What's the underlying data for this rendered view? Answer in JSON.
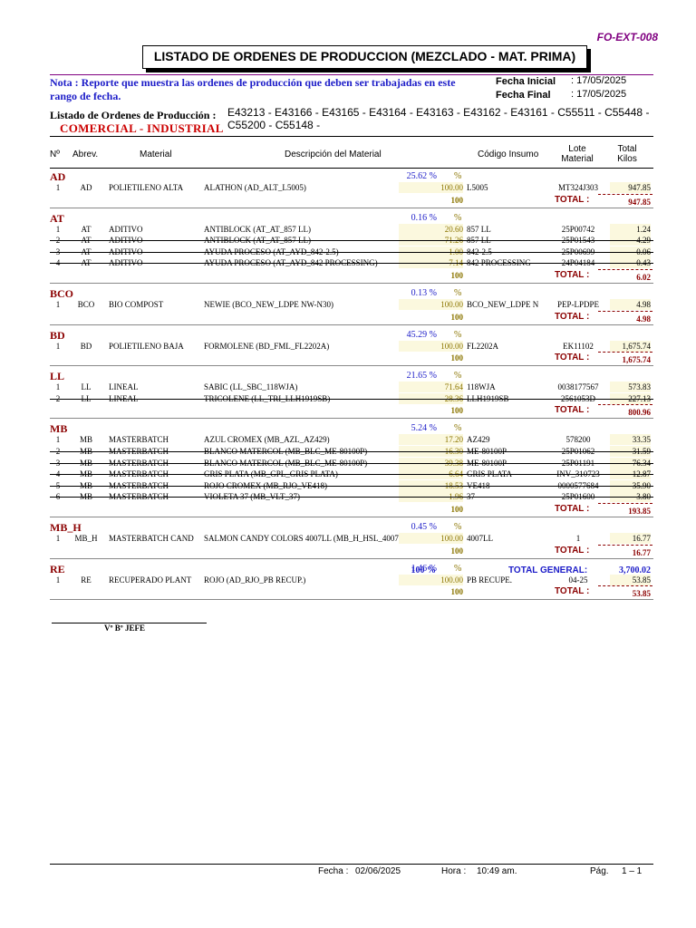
{
  "form_code": "FO-EXT-008",
  "title": "LISTADO DE ORDENES DE PRODUCCION (MEZCLADO - MAT. PRIMA)",
  "note": "Nota : Reporte que muestra las ordenes de producción que deben ser trabajadas en este rango de fecha.",
  "fecha_inicial_label": "Fecha Inicial",
  "fecha_inicial_value": ": 17/05/2025",
  "fecha_final_label": "Fecha Final",
  "fecha_final_value": ": 17/05/2025",
  "orders_label": "Listado de Ordenes de Producción :",
  "orders_list": "E43213 - E43166 - E43165 - E43164 - E43163 - E43162 - E43161 - C55511 - C55448 - C55200 - C55148 -",
  "segment": "COMERCIAL - INDUSTRIAL",
  "headers": {
    "no": "Nº",
    "abrev": "Abrev.",
    "material": "Material",
    "descripcion": "Descripción del Material",
    "codigo": "Código Insumo",
    "lote": "Lote Material",
    "total": "Total Kilos"
  },
  "groups": [
    {
      "code": "AD",
      "pct": "25.62 %",
      "pct_sign": "%",
      "subtotal_pct": "100",
      "total_label": "TOTAL :",
      "total": "947.85",
      "rows": [
        {
          "idx": "1",
          "abr": "AD",
          "mat": "POLIETILENO ALTA",
          "desc": "ALATHON (AD_ALT_L5005)",
          "pct": "100.00",
          "code": "L5005",
          "lote": "MT324J303",
          "kilos": "947.85",
          "strike": false
        }
      ]
    },
    {
      "code": "AT",
      "pct": "0.16 %",
      "pct_sign": "%",
      "subtotal_pct": "100",
      "total_label": "TOTAL :",
      "total": "6.02",
      "rows": [
        {
          "idx": "1",
          "abr": "AT",
          "mat": "ADITIVO",
          "desc": "ANTIBLOCK (AT_AT_857 LL)",
          "pct": "20.60",
          "code": "857 LL",
          "lote": "25P00742",
          "kilos": "1.24",
          "strike": false
        },
        {
          "idx": "2",
          "abr": "AT",
          "mat": "ADITIVO",
          "desc": "ANTIBLOCK (AT_AT_857 LL)",
          "pct": "71.26",
          "code": "857 LL",
          "lote": "25P01543",
          "kilos": "4.29",
          "strike": true
        },
        {
          "idx": "3",
          "abr": "AT",
          "mat": "ADITIVO",
          "desc": "AYUDA PROCESO (AT_AYD_842-2.5)",
          "pct": "1.00",
          "code": "842-2.5",
          "lote": "25P00699",
          "kilos": "0.06",
          "strike": true
        },
        {
          "idx": "4",
          "abr": "AT",
          "mat": "ADITIVO",
          "desc": "AYUDA PROCESO (AT_AYD_842 PROCESSING)",
          "pct": "7.14",
          "code": "842 PROCESSING",
          "lote": "24P04184",
          "kilos": "0.43",
          "strike": true
        }
      ]
    },
    {
      "code": "BCO",
      "pct": "0.13 %",
      "pct_sign": "%",
      "subtotal_pct": "100",
      "total_label": "TOTAL :",
      "total": "4.98",
      "rows": [
        {
          "idx": "1",
          "abr": "BCO",
          "mat": "BIO COMPOST",
          "desc": "NEWIE (BCO_NEW_LDPE NW-N30)",
          "pct": "100.00",
          "code": "BCO_NEW_LDPE N",
          "lote": "PEP-LPDPE",
          "kilos": "4.98",
          "strike": false
        }
      ]
    },
    {
      "code": "BD",
      "pct": "45.29 %",
      "pct_sign": "%",
      "subtotal_pct": "100",
      "total_label": "TOTAL :",
      "total": "1,675.74",
      "rows": [
        {
          "idx": "1",
          "abr": "BD",
          "mat": "POLIETILENO BAJA",
          "desc": "FORMOLENE (BD_FML_FL2202A)",
          "pct": "100.00",
          "code": "FL2202A",
          "lote": "EK11102",
          "kilos": "1,675.74",
          "strike": false
        }
      ]
    },
    {
      "code": "LL",
      "pct": "21.65 %",
      "pct_sign": "%",
      "subtotal_pct": "100",
      "total_label": "TOTAL :",
      "total": "800.96",
      "rows": [
        {
          "idx": "1",
          "abr": "LL",
          "mat": "LINEAL",
          "desc": "SABIC (LL_SBC_118WJA)",
          "pct": "71.64",
          "code": "118WJA",
          "lote": "0038177567",
          "kilos": "573.83",
          "strike": false
        },
        {
          "idx": "2",
          "abr": "LL",
          "mat": "LINEAL",
          "desc": "TRICOLENE (LL_TRI_LLH1919SB)",
          "pct": "28.36",
          "code": "LLH1919SB",
          "lote": "2561053D",
          "kilos": "227.13",
          "strike": true
        }
      ]
    },
    {
      "code": "MB",
      "pct": "5.24 %",
      "pct_sign": "%",
      "subtotal_pct": "100",
      "total_label": "TOTAL :",
      "total": "193.85",
      "rows": [
        {
          "idx": "1",
          "abr": "MB",
          "mat": "MASTERBATCH",
          "desc": "AZUL  CROMEX (MB_AZL_AZ429)",
          "pct": "17.20",
          "code": "AZ429",
          "lote": "578200",
          "kilos": "33.35",
          "strike": false
        },
        {
          "idx": "2",
          "abr": "MB",
          "mat": "MASTERBATCH",
          "desc": "BLANCO MATERCOL (MB_BLC_ME-80100P)",
          "pct": "16.30",
          "code": "ME-80100P",
          "lote": "25P01062",
          "kilos": "31.59",
          "strike": true
        },
        {
          "idx": "3",
          "abr": "MB",
          "mat": "MASTERBATCH",
          "desc": "BLANCO MATERCOL (MB_BLC_ME-80100P)",
          "pct": "39.38",
          "code": "ME-80100P",
          "lote": "25P01191",
          "kilos": "76.34",
          "strike": true
        },
        {
          "idx": "4",
          "abr": "MB",
          "mat": "MASTERBATCH",
          "desc": "GRIS PLATA (MB_GPL_GRIS PLATA)",
          "pct": "6.64",
          "code": "GRIS PLATA",
          "lote": "INV_310723",
          "kilos": "12.87",
          "strike": true
        },
        {
          "idx": "5",
          "abr": "MB",
          "mat": "MASTERBATCH",
          "desc": "ROJO CROMEX (MB_RJO_VE418)",
          "pct": "18.53",
          "code": "VE418",
          "lote": "0000577684",
          "kilos": "35.90",
          "strike": true
        },
        {
          "idx": "6",
          "abr": "MB",
          "mat": "MASTERBATCH",
          "desc": "VIOLETA 37 (MB_VLT_37)",
          "pct": "1.96",
          "code": "37",
          "lote": "25P01600",
          "kilos": "3.80",
          "strike": true
        }
      ]
    },
    {
      "code": "MB_H",
      "pct": "0.45 %",
      "pct_sign": "%",
      "subtotal_pct": "100",
      "total_label": "TOTAL :",
      "total": "16.77",
      "rows": [
        {
          "idx": "1",
          "abr": "MB_H",
          "mat": "MASTERBATCH CAND",
          "desc": "SALMON CANDY COLORS 4007LL (MB_H_HSL_4007LL)",
          "pct": "100.00",
          "code": "4007LL",
          "lote": "1",
          "kilos": "16.77",
          "strike": false
        }
      ]
    },
    {
      "code": "RE",
      "pct": "1.46 %",
      "pct_sign": "%",
      "subtotal_pct": "100",
      "total_label": "TOTAL :",
      "total": "53.85",
      "rows": [
        {
          "idx": "1",
          "abr": "RE",
          "mat": "RECUPERADO PLANT",
          "desc": "ROJO (AD_RJO_PB RECUP.)",
          "pct": "100.00",
          "code": "PB RECUPE.",
          "lote": "04-25",
          "kilos": "53.85",
          "strike": false
        }
      ]
    }
  ],
  "grand_pct": "100 %",
  "grand_label": "TOTAL GENERAL:",
  "grand_total": "3,700.02",
  "sign_label": "Vº Bº JEFE",
  "footer": {
    "fecha_label": "Fecha :",
    "fecha_value": "02/06/2025",
    "hora_label": "Hora :",
    "hora_value": "10:49 am.",
    "pag_label": "Pág.",
    "pag_value": "1 – 1"
  }
}
